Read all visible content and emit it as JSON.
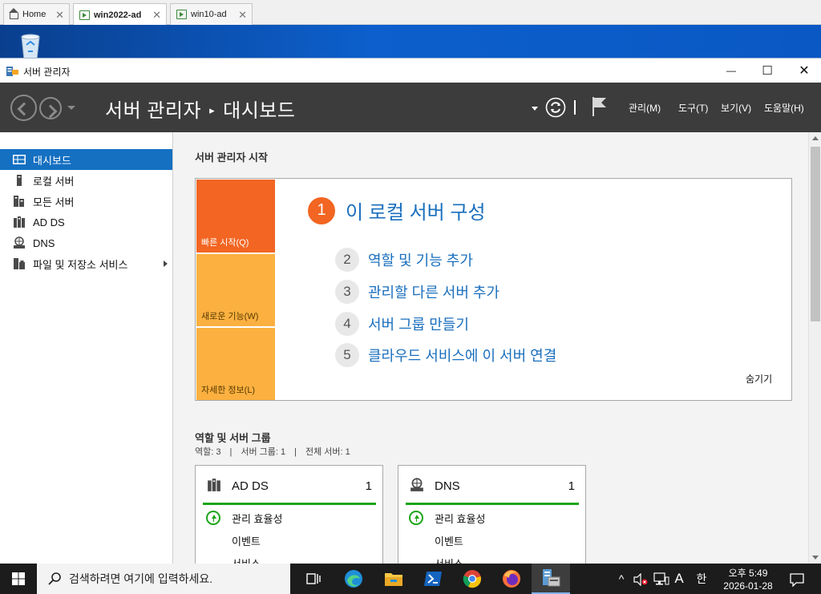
{
  "vm_tabs": [
    {
      "label": "Home"
    },
    {
      "label": "win2022-ad"
    },
    {
      "label": "win10-ad"
    }
  ],
  "window": {
    "title": "서버 관리자",
    "minimize": "—",
    "maximize": "☐",
    "close": "✕"
  },
  "header": {
    "app": "서버 관리자",
    "separator": "▸",
    "page": "대시보드",
    "menus": [
      "관리(M)",
      "도구(T)",
      "보기(V)",
      "도움말(H)"
    ]
  },
  "sidebar": {
    "items": [
      {
        "label": "대시보드",
        "icon": "dashboard-icon"
      },
      {
        "label": "로컬 서버",
        "icon": "local-server-icon"
      },
      {
        "label": "모든 서버",
        "icon": "all-servers-icon"
      },
      {
        "label": "AD DS",
        "icon": "ad-ds-icon"
      },
      {
        "label": "DNS",
        "icon": "dns-icon"
      },
      {
        "label": "파일 및 저장소 서비스",
        "icon": "file-storage-icon"
      }
    ]
  },
  "quickstart": {
    "section_title": "서버 관리자 시작",
    "tiles": [
      "빠른 시작(Q)",
      "새로운 기능(W)",
      "자세한 정보(L)"
    ],
    "step1": {
      "num": "1",
      "label": "이 로컬 서버 구성"
    },
    "steps": [
      {
        "num": "2",
        "label": "역할 및 기능 추가"
      },
      {
        "num": "3",
        "label": "관리할 다른 서버 추가"
      },
      {
        "num": "4",
        "label": "서버 그룹 만들기"
      },
      {
        "num": "5",
        "label": "클라우드 서비스에 이 서버 연결"
      }
    ],
    "hide": "숨기기"
  },
  "roles": {
    "title": "역할 및 서버 그룹",
    "summary": [
      "역할: 3",
      "서버 그룹: 1",
      "전체 서버: 1"
    ],
    "summary_sep": "|",
    "cards": [
      {
        "name": "AD DS",
        "count": "1",
        "rows": [
          "관리 효율성",
          "이벤트",
          "서비스"
        ]
      },
      {
        "name": "DNS",
        "count": "1",
        "rows": [
          "관리 효율성",
          "이벤트",
          "서비스"
        ]
      }
    ]
  },
  "taskbar": {
    "search_placeholder": "검색하려면 여기에 입력하세요.",
    "ime_mode": "A",
    "ime_lang": "한",
    "time": "오후 5:49",
    "date": "2026-01-28"
  },
  "colors": {
    "accent": "#1570c2",
    "header_bg": "#3c3c3c",
    "step1": "#f26522",
    "tile_active": "#f26522",
    "tile": "#fbb040",
    "ok_green": "#1aa51a",
    "link": "#1a6fbe"
  }
}
